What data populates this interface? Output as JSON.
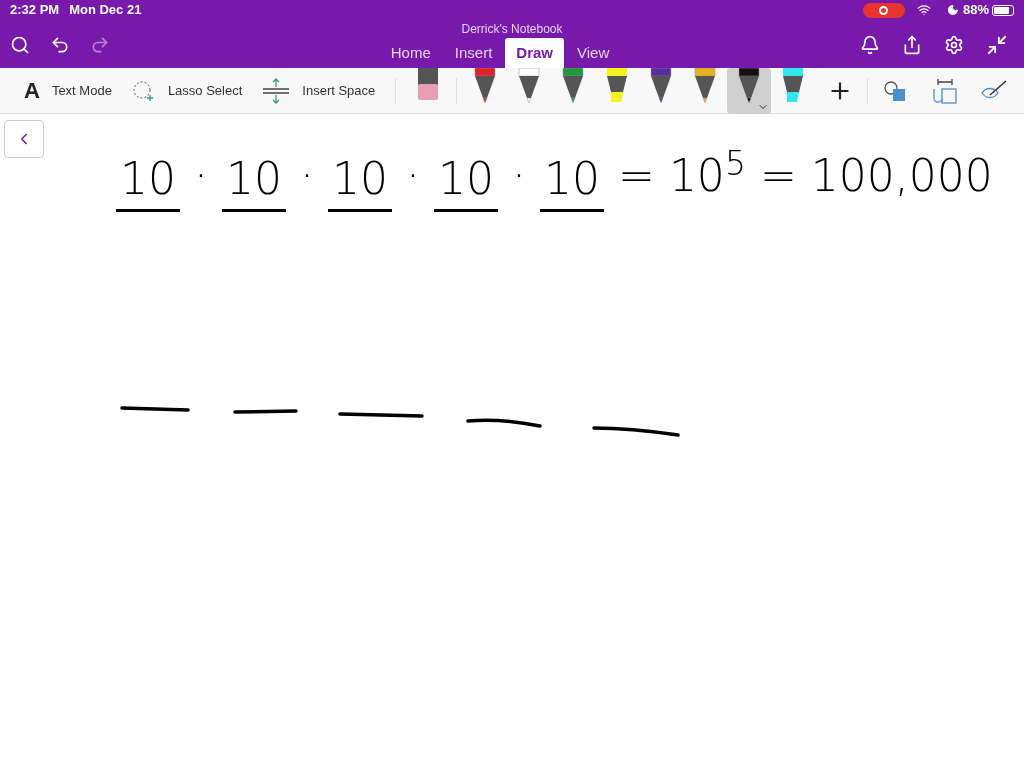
{
  "status_bar": {
    "time": "2:32 PM",
    "date": "Mon Dec 21",
    "recording": true,
    "battery": "88%"
  },
  "window": {
    "title": "Derrick's Notebook"
  },
  "tabs": [
    {
      "label": "Home",
      "selected": false
    },
    {
      "label": "Insert",
      "selected": false
    },
    {
      "label": "Draw",
      "selected": true
    },
    {
      "label": "View",
      "selected": false
    }
  ],
  "tools": [
    {
      "kind": "text",
      "icon": "A",
      "label": "Text Mode"
    },
    {
      "kind": "lasso",
      "label": "Lasso Select"
    },
    {
      "kind": "space",
      "label": "Insert Space"
    }
  ],
  "pens": [
    {
      "kind": "eraser",
      "color": "#e8a0b0",
      "selected": false
    },
    {
      "kind": "pen",
      "color": "#e0202c",
      "selected": false
    },
    {
      "kind": "pen",
      "color": "#ffffff",
      "selected": false
    },
    {
      "kind": "pen",
      "color": "#1f9a3a",
      "selected": false
    },
    {
      "kind": "highlighter",
      "color": "#f5f01e",
      "selected": false
    },
    {
      "kind": "pen",
      "color": "#5a2d9a",
      "selected": false
    },
    {
      "kind": "pen",
      "color": "#e8b020",
      "selected": false
    },
    {
      "kind": "pen",
      "color": "#111111",
      "selected": true
    },
    {
      "kind": "highlighter",
      "color": "#30e8f0",
      "selected": false
    }
  ],
  "ink": [
    {
      "text": "10",
      "underlined": true
    },
    {
      "text": "·",
      "underlined": false
    },
    {
      "text": "10",
      "underlined": true
    },
    {
      "text": "·",
      "underlined": false
    },
    {
      "text": "10",
      "underlined": true
    },
    {
      "text": "·",
      "underlined": false
    },
    {
      "text": "10",
      "underlined": true
    },
    {
      "text": "·",
      "underlined": false
    },
    {
      "text": "10",
      "underlined": true
    },
    {
      "text": "=",
      "underlined": false
    },
    {
      "text": "10$^{5}$",
      "underlined": false
    },
    {
      "text": "=",
      "underlined": false
    },
    {
      "text": "100,000",
      "underlined": false
    }
  ]
}
